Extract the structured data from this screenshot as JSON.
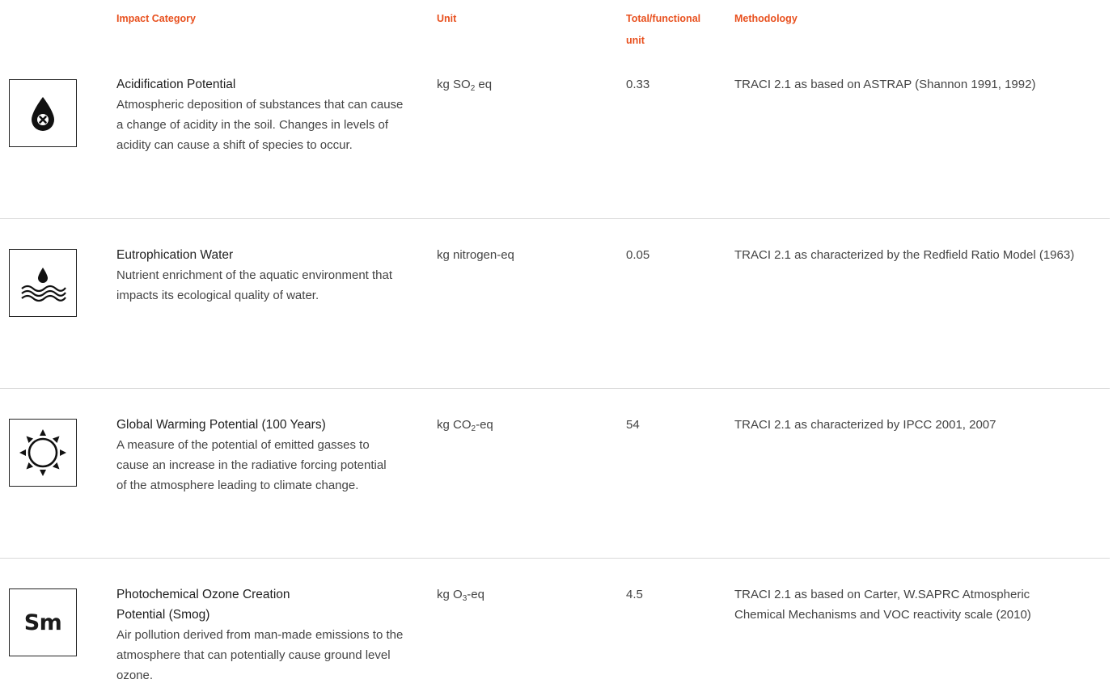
{
  "headers": {
    "impact_category": "Impact Category",
    "unit": "Unit",
    "total_line1": "Total/functional",
    "total_line2": "unit",
    "methodology": "Methodology"
  },
  "accent_color": "#e8501e",
  "rows": [
    {
      "icon": "drop-x-icon",
      "title": "Acidification Potential",
      "description": "Atmospheric deposition of substances that can cause a change of acidity in the soil. Changes in levels of acidity can cause a shift of species to occur.",
      "unit_prefix": "kg SO",
      "unit_sub": "2",
      "unit_suffix": " eq",
      "total": "0.33",
      "methodology": "TRACI 2.1 as based on ASTRAP (Shannon 1991, 1992)"
    },
    {
      "icon": "drop-waves-icon",
      "title": "Eutrophication Water",
      "description": "Nutrient enrichment of the aquatic environment that impacts its ecological quality of water.",
      "unit_prefix": "kg nitrogen-eq",
      "unit_sub": "",
      "unit_suffix": "",
      "total": "0.05",
      "methodology": "TRACI 2.1 as characterized by the Redfield Ratio Model (1963)"
    },
    {
      "icon": "sun-icon",
      "title": "Global Warming Potential (100 Years)",
      "description": "A measure of the potential of emitted gasses to cause an increase in the radiative forcing potential of the atmosphere leading to climate change.",
      "unit_prefix": "kg CO",
      "unit_sub": "2",
      "unit_suffix": "-eq",
      "total": "54",
      "methodology": "TRACI 2.1 as characterized by IPCC 2001, 2007"
    },
    {
      "icon": "smog-icon",
      "icon_text": "Sm",
      "title": "Photochemical Ozone Creation Potential (Smog)",
      "description": "Air pollution derived from man-made emissions to the atmosphere that can potentially cause ground level ozone.",
      "unit_prefix": "kg O",
      "unit_sub": "3",
      "unit_suffix": "-eq",
      "total": "4.5",
      "methodology": "TRACI 2.1 as based on Carter, W.SAPRC Atmospheric Chemical Mechanisms and VOC reactivity scale (2010)"
    }
  ]
}
